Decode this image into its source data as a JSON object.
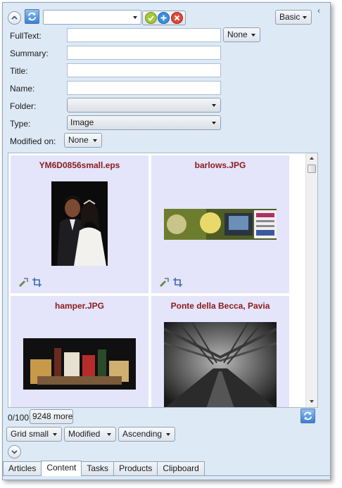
{
  "toolbar": {
    "search_combo_value": "",
    "mode_button": "Basic",
    "expand_icon": "chevron-up-circle-icon",
    "refresh_icon": "refresh-icon",
    "actions": [
      "check-icon",
      "plus-icon",
      "remove-icon"
    ]
  },
  "filters": {
    "fulltext_label": "FullText:",
    "fulltext_value": "",
    "fulltext_scope": "None",
    "summary_label": "Summary:",
    "summary_value": "",
    "title_label": "Title:",
    "title_value": "",
    "name_label": "Name:",
    "name_value": "",
    "folder_label": "Folder:",
    "folder_value": "",
    "type_label": "Type:",
    "type_value": "Image",
    "modified_label": "Modified on:",
    "modified_value": "None"
  },
  "results": {
    "items": [
      {
        "title": "YM6D0856small.eps",
        "thumb": "wedding-couple-photo"
      },
      {
        "title": "barlows.JPG",
        "thumb": "banner-advert"
      },
      {
        "title": "hamper.JPG",
        "thumb": "gift-hamper-photo"
      },
      {
        "title": "Ponte della Becca, Pavia",
        "thumb": "bridge-photo"
      }
    ]
  },
  "footer": {
    "count": "0/100",
    "more_button": "9248 more",
    "view_mode": "Grid small",
    "sort_field": "Modified",
    "sort_order": "Ascending"
  },
  "tabs": [
    "Articles",
    "Content",
    "Tasks",
    "Products",
    "Clipboard"
  ],
  "active_tab": "Content",
  "colors": {
    "panel_bg": "#dde9f4",
    "cell_bg": "#e4e4fb",
    "title_text": "#8b1a1a"
  }
}
